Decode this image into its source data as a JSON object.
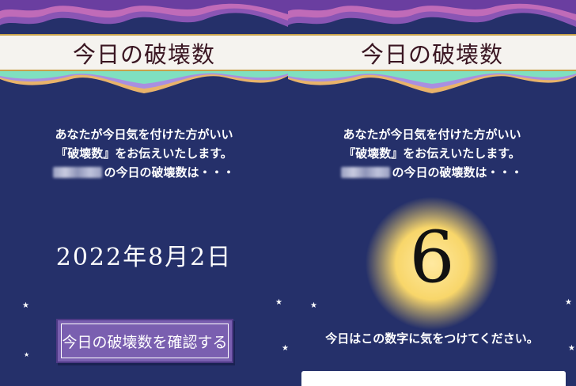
{
  "left": {
    "title": "今日の破壊数",
    "intro_line1": "あなたが今日気を付けた方がいい",
    "intro_line2": "『破壊数』をお伝えいたします。",
    "intro_line3": "の今日の破壊数は・・・",
    "date": "2022年8月2日",
    "button_label": "今日の破壊数を確認する"
  },
  "right": {
    "title": "今日の破壊数",
    "intro_line1": "あなたが今日気を付けた方がいい",
    "intro_line2": "『破壊数』をお伝えいたします。",
    "intro_line3": "の今日の破壊数は・・・",
    "number": "6",
    "caution": "今日はこの数字に気をつけてください。"
  },
  "colors": {
    "background": "#25306a",
    "title_bar": "#f5f3ef",
    "title_text": "#3a1622",
    "button": "#7a5fb0",
    "orb": "#f8d66a"
  },
  "icons": {
    "star": "star-icon"
  }
}
